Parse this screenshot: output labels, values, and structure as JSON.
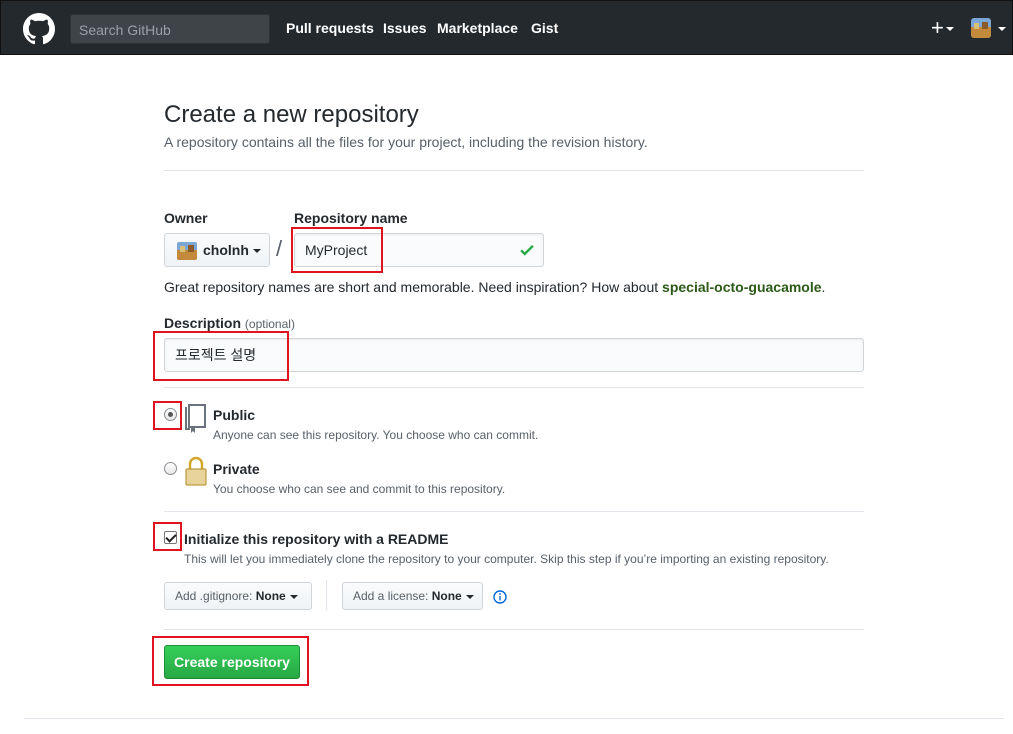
{
  "header": {
    "search_placeholder": "Search GitHub",
    "nav": [
      "Pull requests",
      "Issues",
      "Marketplace",
      "Gist"
    ],
    "plus": "+"
  },
  "page": {
    "title": "Create a new repository",
    "subtitle": "A repository contains all the files for your project, including the revision history."
  },
  "form": {
    "owner_label": "Owner",
    "owner_value": "cholnh",
    "slash": "/",
    "repo_label": "Repository name",
    "repo_value": "MyProject",
    "hint_text": "Great repository names are short and memorable. Need inspiration? How about ",
    "hint_suggestion": "special-octo-guacamole",
    "hint_end": ".",
    "description_label": "Description",
    "description_optional": "(optional)",
    "description_value": "프로젝트 설명",
    "visibility": [
      {
        "title": "Public",
        "note": "Anyone can see this repository. You choose who can commit.",
        "selected": true
      },
      {
        "title": "Private",
        "note": "You choose who can see and commit to this repository.",
        "selected": false
      }
    ],
    "readme_label": "Initialize this repository with a README",
    "readme_note": "This will let you immediately clone the repository to your computer. Skip this step if you’re importing an existing repository.",
    "readme_checked": true,
    "gitignore_label": "Add .gitignore:",
    "gitignore_value": "None",
    "license_label": "Add a license:",
    "license_value": "None",
    "create_button": "Create repository"
  },
  "colors": {
    "header_bg": "#24292e",
    "primary_button": "#28a745",
    "highlight": "#e0141e",
    "suggestion": "#2c5a16"
  }
}
